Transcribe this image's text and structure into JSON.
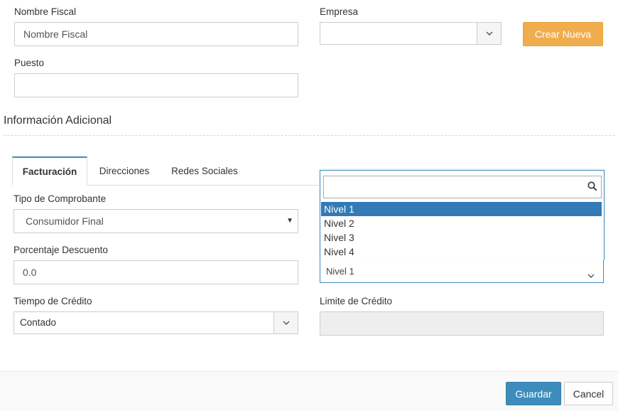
{
  "form": {
    "nombre_fiscal": {
      "label": "Nombre Fiscal",
      "value": "Nombre Fiscal"
    },
    "empresa": {
      "label": "Empresa",
      "value": ""
    },
    "crear_nueva_label": "Crear Nueva",
    "puesto": {
      "label": "Puesto",
      "value": ""
    }
  },
  "section_title": "Información Adicional",
  "tabs": [
    {
      "label": "Facturación",
      "active": true
    },
    {
      "label": "Direcciones",
      "active": false
    },
    {
      "label": "Redes Sociales",
      "active": false
    }
  ],
  "billing": {
    "tipo_comprobante": {
      "label": "Tipo de Comprobante",
      "value": "Consumidor Final"
    },
    "porcentaje_descuento": {
      "label": "Porcentaje Descuento",
      "value": "0.0"
    },
    "tiempo_credito": {
      "label": "Tiempo de Crédito",
      "value": "Contado"
    },
    "limite_credito": {
      "label": "Limite de Crédito",
      "value": ""
    },
    "nivel": {
      "value": "Nivel 1"
    }
  },
  "dropdown": {
    "search_value": "",
    "options": [
      "Nivel 1",
      "Nivel 2",
      "Nivel 3",
      "Nivel 4"
    ],
    "highlighted": "Nivel 1"
  },
  "footer": {
    "save_label": "Guardar",
    "cancel_label": "Cancel"
  },
  "colors": {
    "primary": "#3c8dbc",
    "warning": "#f0ad4e",
    "highlight": "#337ab7"
  }
}
